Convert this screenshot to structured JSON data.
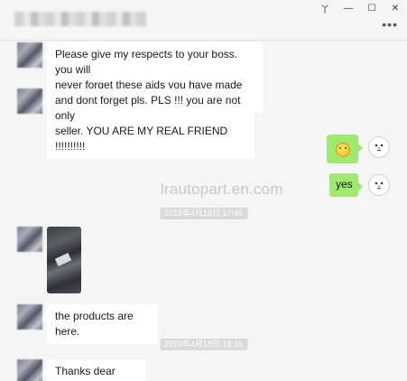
{
  "window": {
    "controls": {
      "pin": "丫",
      "minimize": "—",
      "maximize": "☐",
      "close": "✕"
    },
    "more": "•••"
  },
  "watermark": "lrautopart.en.com",
  "messages": [
    {
      "side": "left",
      "lines": [
        "Please give my respects to your boss. you will",
        "never forget these aids you have made me."
      ]
    },
    {
      "side": "left",
      "lines": [
        "and dont forget pls. PLS !!! you are not only",
        "seller. YOU ARE MY REAL FRIEND !!!!!!!!!!"
      ]
    },
    {
      "side": "right",
      "emoji": "smile-emoji"
    },
    {
      "side": "right",
      "text": "yes"
    },
    {
      "side": "timestamp",
      "text": "2019年4月18日 17:45"
    },
    {
      "side": "left",
      "image": "product-photo"
    },
    {
      "side": "left",
      "text": "the products are here."
    },
    {
      "side": "timestamp",
      "text": "2019年4月18日 18:16"
    },
    {
      "side": "left",
      "text": "Thanks dear friend"
    }
  ],
  "colors": {
    "background": "#f5f5f5",
    "bubble_self": "#9fe872",
    "bubble_other": "#ffffff",
    "timestamp_bg": "#dadada"
  }
}
